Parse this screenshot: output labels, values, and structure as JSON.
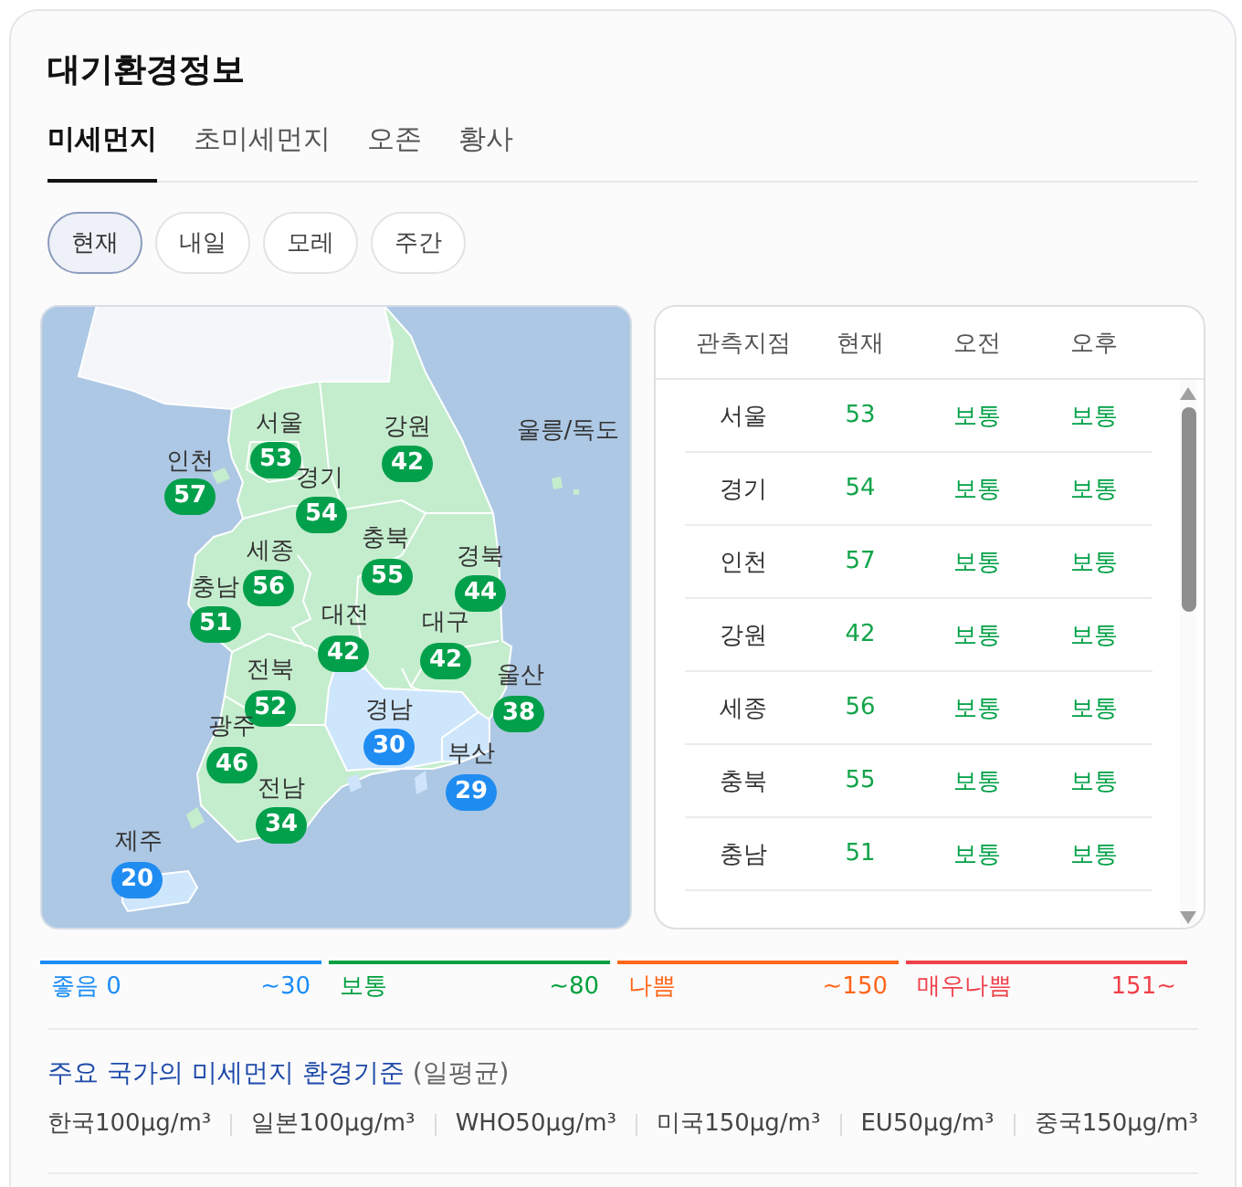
{
  "title": "대기환경정보",
  "tabs": [
    {
      "label": "미세먼지",
      "selected": true
    },
    {
      "label": "초미세먼지",
      "selected": false
    },
    {
      "label": "오존",
      "selected": false
    },
    {
      "label": "황사",
      "selected": false
    }
  ],
  "periods": [
    {
      "label": "현재",
      "selected": true
    },
    {
      "label": "내일",
      "selected": false
    },
    {
      "label": "모레",
      "selected": false
    },
    {
      "label": "주간",
      "selected": false
    }
  ],
  "map": {
    "regions": [
      {
        "name": "서울",
        "value": "53",
        "color": "#03a04c"
      },
      {
        "name": "강원",
        "value": "42",
        "color": "#03a04c"
      },
      {
        "name": "인천",
        "value": "57",
        "color": "#03a04c"
      },
      {
        "name": "경기",
        "value": "54",
        "color": "#03a04c"
      },
      {
        "name": "충북",
        "value": "55",
        "color": "#03a04c"
      },
      {
        "name": "세종",
        "value": "56",
        "color": "#03a04c"
      },
      {
        "name": "경북",
        "value": "44",
        "color": "#03a04c"
      },
      {
        "name": "충남",
        "value": "51",
        "color": "#03a04c"
      },
      {
        "name": "대전",
        "value": "42",
        "color": "#03a04c"
      },
      {
        "name": "대구",
        "value": "42",
        "color": "#03a04c"
      },
      {
        "name": "전북",
        "value": "52",
        "color": "#03a04c"
      },
      {
        "name": "울산",
        "value": "38",
        "color": "#03a04c"
      },
      {
        "name": "경남",
        "value": "30",
        "color": "#1f8cf2"
      },
      {
        "name": "광주",
        "value": "46",
        "color": "#03a04c"
      },
      {
        "name": "부산",
        "value": "29",
        "color": "#1f8cf2"
      },
      {
        "name": "전남",
        "value": "34",
        "color": "#03a04c"
      },
      {
        "name": "제주",
        "value": "20",
        "color": "#1f8cf2"
      }
    ],
    "island_label": "울릉/독도"
  },
  "table": {
    "columns": [
      "관측지점",
      "현재",
      "오전",
      "오후"
    ],
    "rows": [
      {
        "station": "서울",
        "now": {
          "text": "53",
          "color": "#12a44a"
        },
        "am": {
          "text": "보통",
          "color": "#00a046"
        },
        "pm": {
          "text": "보통",
          "color": "#00a046"
        }
      },
      {
        "station": "경기",
        "now": {
          "text": "54",
          "color": "#12a44a"
        },
        "am": {
          "text": "보통",
          "color": "#00a046"
        },
        "pm": {
          "text": "보통",
          "color": "#00a046"
        }
      },
      {
        "station": "인천",
        "now": {
          "text": "57",
          "color": "#12a44a"
        },
        "am": {
          "text": "보통",
          "color": "#00a046"
        },
        "pm": {
          "text": "보통",
          "color": "#00a046"
        }
      },
      {
        "station": "강원",
        "now": {
          "text": "42",
          "color": "#12a44a"
        },
        "am": {
          "text": "보통",
          "color": "#00a046"
        },
        "pm": {
          "text": "보통",
          "color": "#00a046"
        }
      },
      {
        "station": "세종",
        "now": {
          "text": "56",
          "color": "#12a44a"
        },
        "am": {
          "text": "보통",
          "color": "#00a046"
        },
        "pm": {
          "text": "보통",
          "color": "#00a046"
        }
      },
      {
        "station": "충북",
        "now": {
          "text": "55",
          "color": "#12a44a"
        },
        "am": {
          "text": "보통",
          "color": "#00a046"
        },
        "pm": {
          "text": "보통",
          "color": "#00a046"
        }
      },
      {
        "station": "충남",
        "now": {
          "text": "51",
          "color": "#12a44a"
        },
        "am": {
          "text": "보통",
          "color": "#00a046"
        },
        "pm": {
          "text": "보통",
          "color": "#00a046"
        }
      }
    ]
  },
  "legend": [
    {
      "label": "좋음 0",
      "range": "~30",
      "color": "#1a8cf5"
    },
    {
      "label": "보통",
      "range": "~80",
      "color": "#00a03e"
    },
    {
      "label": "나쁨",
      "range": "~150",
      "color": "#ff661a"
    },
    {
      "label": "매우나쁨",
      "range": "151~",
      "color": "#f0404a"
    }
  ],
  "standards": {
    "title": "주요 국가의 미세먼지 환경기준",
    "note": "(일평균)",
    "items": [
      "한국100μg/m³",
      "일본100μg/m³",
      "WHO50μg/m³",
      "미국150μg/m³",
      "EU50μg/m³",
      "중국150μg/m³"
    ]
  }
}
